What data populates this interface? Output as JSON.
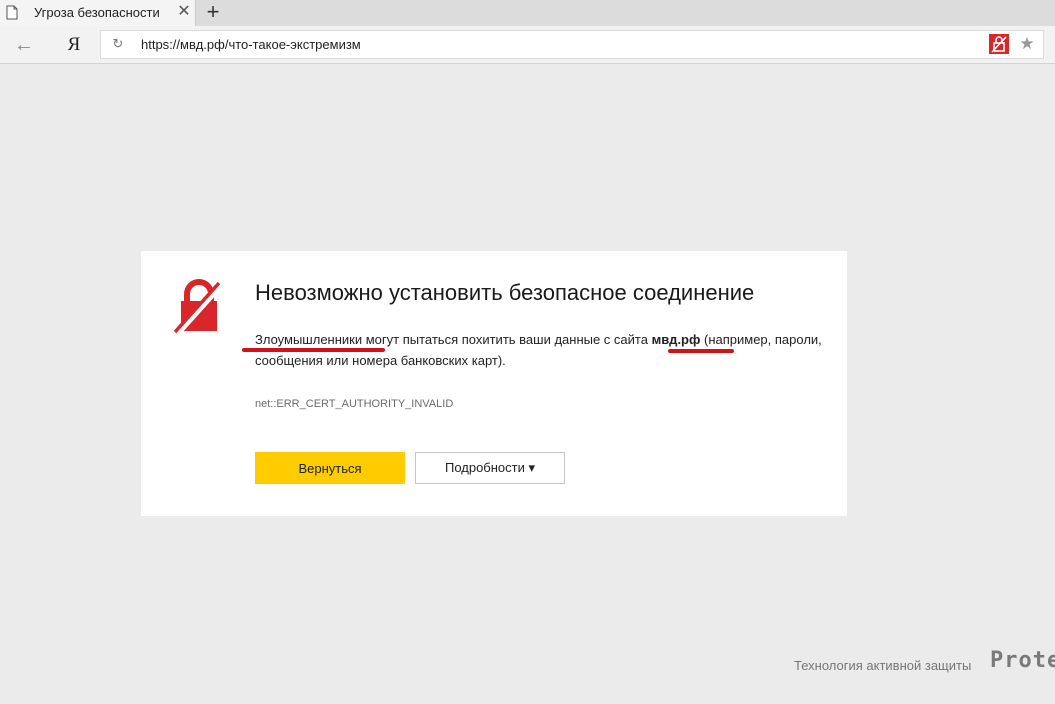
{
  "tab": {
    "title": "Угроза безопасности",
    "icon": "page-icon",
    "close_glyph": "✕"
  },
  "new_tab_glyph": "+",
  "toolbar": {
    "back_glyph": "←",
    "logo": "Я",
    "reload_glyph": "↻",
    "url": "https://мвд.рф/что-такое-экстремизм",
    "protect_icon": "broken-lock-icon",
    "star_glyph": "★"
  },
  "warning": {
    "heading": "Невозможно установить безопасное соединение",
    "desc_before": "Злоумышленники могут пытаться похитить ваши данные с сайта ",
    "desc_site": "мвд.рф",
    "desc_after": " (например, пароли, сообщения или номера банковских карт).",
    "error_code": "net::ERR_CERT_AUTHORITY_INVALID",
    "back_button": "Вернуться",
    "details_button": "Подробности ▾",
    "accent_color": "#d9262b",
    "primary_color": "#ffcc00"
  },
  "footer": {
    "text": "Технология активной защиты",
    "brand": "Prote"
  }
}
